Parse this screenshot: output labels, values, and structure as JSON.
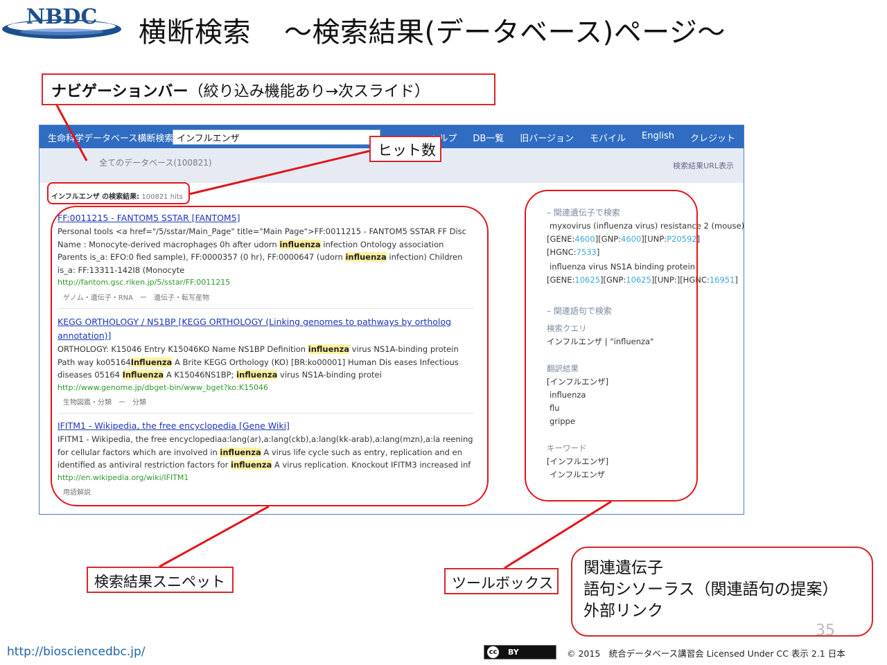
{
  "slide": {
    "logo_text": "NBDC",
    "title": "横断検索",
    "subtitle": "～検索結果(データベース)ページ～",
    "page_number": "35",
    "site_url": "http://biosciencedbc.jp/",
    "cc_badge": "BY",
    "copyright": "© 2015　統合データベース講習会 Licensed Under CC 表示 2.1 日本"
  },
  "callouts": {
    "nav_bold": "ナビゲーションバー",
    "nav_rest": "（絞り込み機能あり→次スライド）",
    "hit_count": "ヒット数",
    "snippet": "検索結果スニペット",
    "toolbox": "ツールボックス",
    "related": [
      "関連遺伝子",
      "語句シソーラス（関連語句の提案）",
      "外部リンク"
    ]
  },
  "screenshot": {
    "brand": "生命科学データベース横断検索",
    "search_value": "インフルエンザ",
    "nav_links": [
      "ヘルプ",
      "DB一覧",
      "旧バージョン",
      "モバイル",
      "English",
      "クレジット"
    ],
    "all_db": "全てのデータベース(100821)",
    "url_show": "検索結果URL表示",
    "hits_label": "インフルエンザ の検索結果:",
    "hits_count": "100821 hits",
    "results": [
      {
        "title": "FF:0011215 - FANTOM5 SSTAR [FANTOM5]",
        "snippet_parts": [
          "Personal tools <a href=\"/5/sstar/Main_Page\" title=\"Main Page\">FF:0011215 - FANTOM5 SSTAR FF Disc Name : Monocyte-derived macrophages 0h after udorn ",
          "influenza",
          " infection Ontology association Parents is_a: EFO:0 fied sample), FF:0000357 (0 hr), FF:0000647 (udorn ",
          "influenza",
          " infection) Children is_a: FF:13311-142I8 (Monocyte"
        ],
        "url": "http://fantom.gsc.riken.jp/5/sstar/FF:0011215",
        "category": "ゲノム・遺伝子・RNA　ー　遺伝子・転写産物"
      },
      {
        "title": "KEGG ORTHOLOGY / NS1BP [KEGG ORTHOLOGY (Linking genomes to pathways by ortholog annotation)]",
        "snippet_parts": [
          "ORTHOLOGY: K15046 Entry K15046KO Name NS1BP Definition ",
          "influenza",
          " virus NS1A-binding protein Path way ko05164",
          "Influenza",
          " A Brite KEGG Orthology (KO) [BR:ko00001] Human Dis eases Infectious diseases 05164 ",
          "Influenza",
          " A K15046NS1BP; ",
          "influenza",
          " virus NS1A-binding protei"
        ],
        "url": "http://www.genome.jp/dbget-bin/www_bget?ko:K15046",
        "category": "生物図鑑・分類　ー　分類"
      },
      {
        "title": "IFITM1 - Wikipedia, the free encyclopedia [Gene Wiki]",
        "snippet_parts": [
          "IFITM1 - Wikipedia, the free encyclopediaa:lang(ar),a:lang(ckb),a:lang(kk-arab),a:lang(mzn),a:la reening for cellular factors which are involved in ",
          "influenza",
          " A virus life cycle such as entry, replication and en identified as antiviral restriction factors for ",
          "influenza",
          " A virus replication. Knockout IFITM3 increased inf"
        ],
        "url": "http://en.wikipedia.org/wiki/IFITM1",
        "category": "用語解説"
      }
    ],
    "toolbox": {
      "gene_head": "– 関連遺伝子で検索",
      "gene1_name": "myxovirus (influenza virus) resistance 2 (mouse)",
      "gene1_ids": [
        "4600",
        "4600",
        "P20592",
        "7533"
      ],
      "gene2_name": "influenza virus NS1A binding protein",
      "gene2_ids": [
        "10625",
        "10625",
        "16951"
      ],
      "thesaurus_head": "– 関連語句で検索",
      "query_label": "検索クエリ",
      "query_value": "インフルエンザ | \"influenza\"",
      "translation_label": "翻訳結果",
      "translation_src": "[インフルエンザ]",
      "translations": [
        "influenza",
        "flu",
        "grippe"
      ],
      "keyword_label": "キーワード",
      "keyword_src": "[インフルエンザ]",
      "keyword_value": "インフルエンザ"
    }
  },
  "colors": {
    "accent_red": "#e3141b",
    "topbar_blue": "#2f6cc2",
    "link_blue": "#1a35b8",
    "url_green": "#2c9a2c",
    "highlight": "#fff2a0"
  }
}
